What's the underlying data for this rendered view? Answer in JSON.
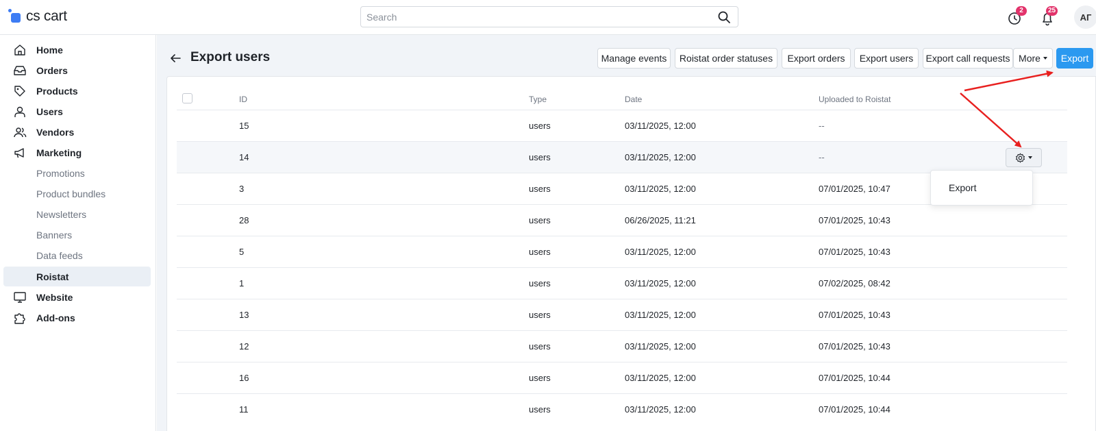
{
  "app": {
    "logo_text": "cs cart",
    "brand_color": "#3d7cf4",
    "accent_color": "#2b99f0",
    "badge_color": "#e2336b"
  },
  "topbar": {
    "search": {
      "placeholder": "Search",
      "value": "",
      "icon": "search-icon"
    },
    "help": {
      "icon": "help-icon",
      "badge": "2"
    },
    "notifications": {
      "icon": "bell-icon",
      "badge": "25"
    },
    "avatar": {
      "initials": "АГ"
    }
  },
  "sidebar": {
    "items": [
      {
        "label": "Home",
        "icon": "home-icon"
      },
      {
        "label": "Orders",
        "icon": "orders-icon"
      },
      {
        "label": "Products",
        "icon": "tag-icon"
      },
      {
        "label": "Users",
        "icon": "user-icon"
      },
      {
        "label": "Vendors",
        "icon": "vendors-icon"
      },
      {
        "label": "Marketing",
        "icon": "megaphone-icon"
      },
      {
        "label": "Promotions"
      },
      {
        "label": "Product bundles"
      },
      {
        "label": "Newsletters"
      },
      {
        "label": "Banners"
      },
      {
        "label": "Data feeds"
      },
      {
        "label": "Roistat",
        "active": true
      },
      {
        "label": "Website",
        "icon": "monitor-icon"
      },
      {
        "label": "Add-ons",
        "icon": "puzzle-icon"
      }
    ]
  },
  "page": {
    "title": "Export users",
    "toolbar": {
      "manage_events": "Manage events",
      "roistat_order_statuses": "Roistat order statuses",
      "export_orders": "Export orders",
      "export_users": "Export users",
      "export_call_requests": "Export call requests",
      "more": "More",
      "export": "Export"
    }
  },
  "table": {
    "columns": {
      "id": "ID",
      "type": "Type",
      "date": "Date",
      "uploaded": "Uploaded to Roistat"
    },
    "rows": [
      {
        "id": "15",
        "type": "users",
        "date": "03/11/2025, 12:00",
        "uploaded": "--"
      },
      {
        "id": "14",
        "type": "users",
        "date": "03/11/2025, 12:00",
        "uploaded": "--"
      },
      {
        "id": "3",
        "type": "users",
        "date": "03/11/2025, 12:00",
        "uploaded": "07/01/2025, 10:47"
      },
      {
        "id": "28",
        "type": "users",
        "date": "06/26/2025, 11:21",
        "uploaded": "07/01/2025, 10:43"
      },
      {
        "id": "5",
        "type": "users",
        "date": "03/11/2025, 12:00",
        "uploaded": "07/01/2025, 10:43"
      },
      {
        "id": "1",
        "type": "users",
        "date": "03/11/2025, 12:00",
        "uploaded": "07/02/2025, 08:42"
      },
      {
        "id": "13",
        "type": "users",
        "date": "03/11/2025, 12:00",
        "uploaded": "07/01/2025, 10:43"
      },
      {
        "id": "12",
        "type": "users",
        "date": "03/11/2025, 12:00",
        "uploaded": "07/01/2025, 10:43"
      },
      {
        "id": "16",
        "type": "users",
        "date": "03/11/2025, 12:00",
        "uploaded": "07/01/2025, 10:44"
      },
      {
        "id": "11",
        "type": "users",
        "date": "03/11/2025, 12:00",
        "uploaded": "07/01/2025, 10:44"
      }
    ],
    "row_actions": {
      "icon": "gear-icon",
      "menu": {
        "export": "Export"
      }
    }
  },
  "annotations": {
    "arrow_color": "#e8201f"
  }
}
